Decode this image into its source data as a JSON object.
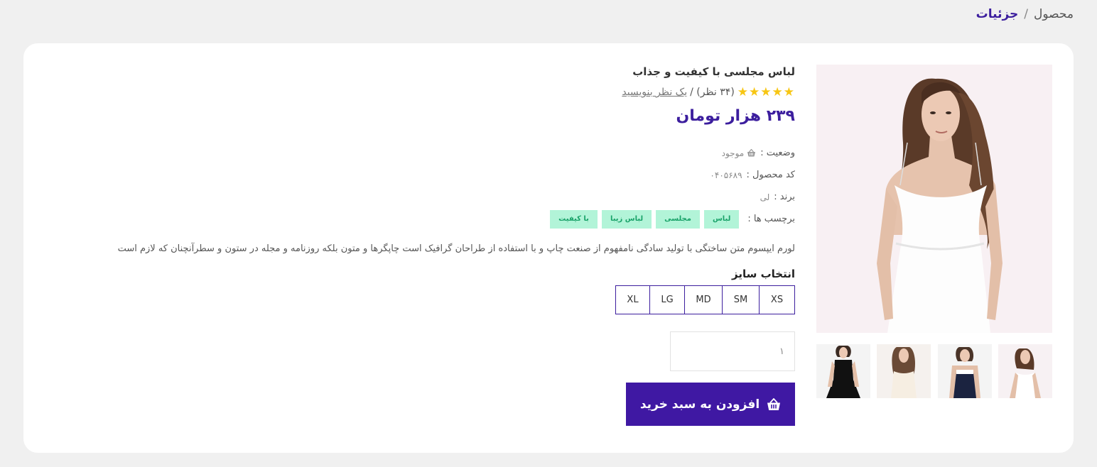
{
  "breadcrumb": {
    "first": "محصول",
    "separator": "/",
    "current": "جزئیات"
  },
  "product": {
    "title": "لباس مجلسی با کیفیت و جذاب",
    "stars": "★★★★★",
    "reviews_count": "(۳۴ نظر) /",
    "write_review": "یک نظر بنویسید",
    "price": "۲۳۹ هزار تومان",
    "status_label": "وضعیت :",
    "status_value": "موجود",
    "code_label": "کد محصول :",
    "code_value": "۰۴۰۵۶۸۹",
    "brand_label": "برند :",
    "brand_value": "لی",
    "tags_label": "برچسب ها :",
    "tags": [
      "لباس",
      "مجلسی",
      "لباس زیبا",
      "با کیفیت"
    ],
    "description": "لورم ایپسوم متن ساختگی با تولید سادگی نامفهوم از صنعت چاپ و با استفاده از طراحان گرافیک است چاپگرها و متون بلکه روزنامه و مجله در ستون و سطرآنچنان که لازم است",
    "size_label": "انتخاب سایز",
    "sizes": [
      "XS",
      "SM",
      "MD",
      "LG",
      "XL"
    ],
    "quantity": "۱",
    "add_to_cart": "افزودن به سبد خرید",
    "cart_icon": "shopping-basket-icon"
  },
  "colors": {
    "accent": "#3f18a3",
    "tag_bg": "#b2f4d8",
    "tag_text": "#1aa36a",
    "star": "#f7c614"
  }
}
